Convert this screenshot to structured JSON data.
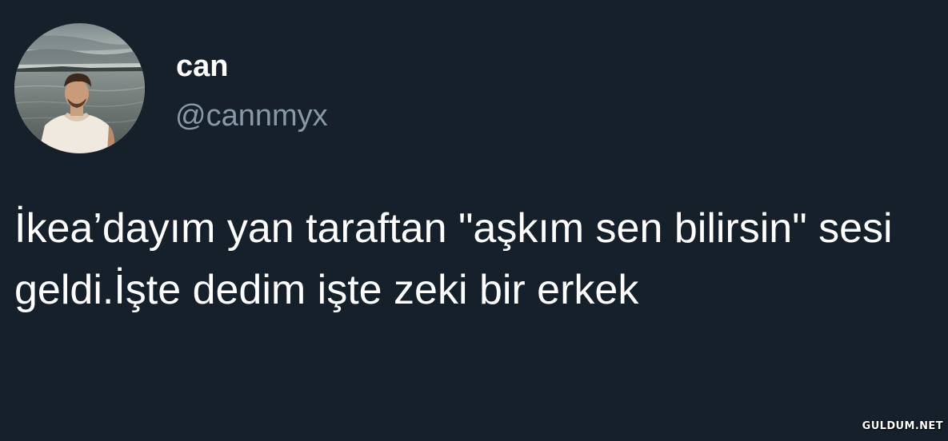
{
  "tweet": {
    "author": {
      "display_name": "can",
      "handle": "@cannmyx",
      "avatar_icon": "profile-photo-man-by-sea"
    },
    "text": "İkea’dayım yan taraftan \"aşkım sen bilirsin\" sesi geldi.İşte dedim işte zeki bir erkek"
  },
  "watermark": {
    "text": "GULDUM.NET"
  },
  "colors": {
    "background": "#15202b",
    "primary_text": "#ffffff",
    "secondary_text": "#8899a6"
  }
}
